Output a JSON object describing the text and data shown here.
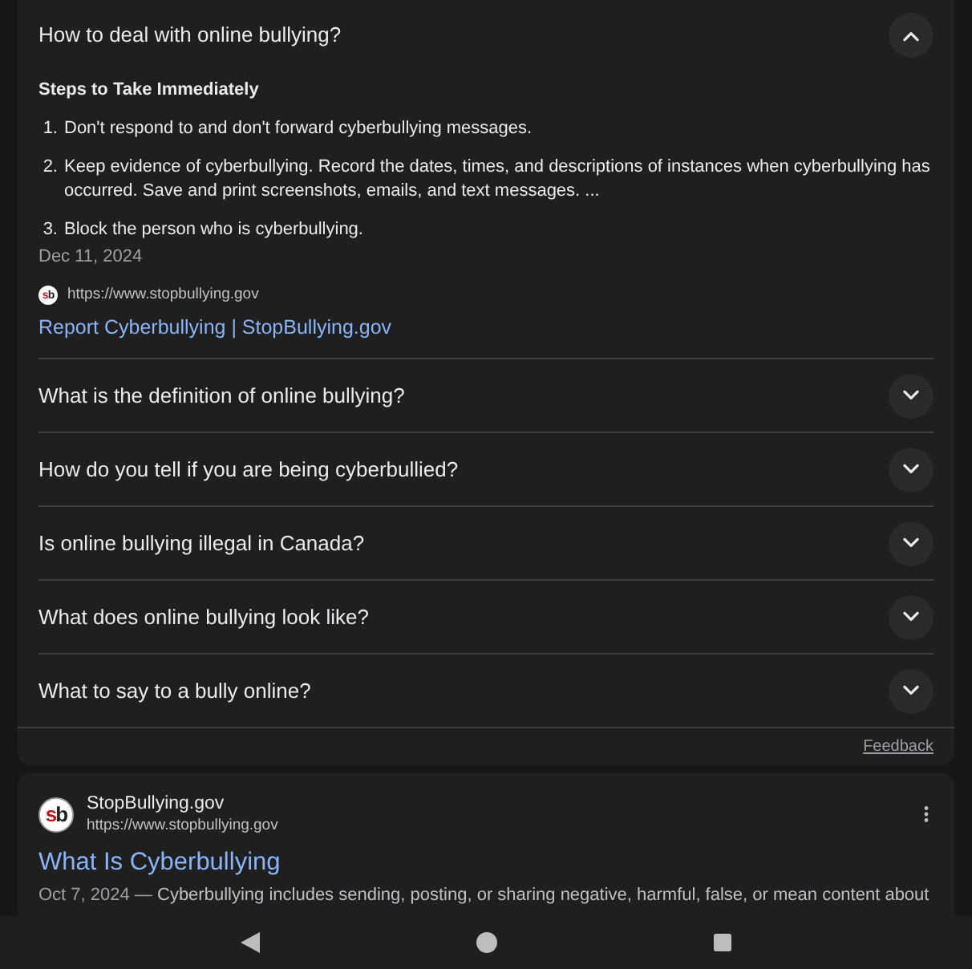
{
  "expanded_question": {
    "question": "How to deal with online bullying?",
    "expanded": true,
    "answer": {
      "heading": "Steps to Take Immediately",
      "steps": [
        {
          "number": "1.",
          "text": "Don't respond to and don't forward cyberbullying messages."
        },
        {
          "number": "2.",
          "text": "Keep evidence of cyberbullying. Record the dates, times, and descriptions of instances when cyberbullying has occurred. Save and print screenshots, emails, and text messages. ..."
        },
        {
          "number": "3.",
          "text": "Block the person who is cyberbullying."
        }
      ],
      "date": "Dec 11, 2024",
      "source_logo": "sb",
      "source_url": "https://www.stopbullying.gov",
      "source_title": "Report Cyberbullying | StopBullying.gov"
    }
  },
  "related_questions": [
    {
      "question": "What is the definition of online bullying?",
      "expanded": false
    },
    {
      "question": "How do you tell if you are being cyberbullied?",
      "expanded": false
    },
    {
      "question": "Is online bullying illegal in Canada?",
      "expanded": false
    },
    {
      "question": "What does online bullying look like?",
      "expanded": false
    },
    {
      "question": "What to say to a bully online?",
      "expanded": false
    }
  ],
  "feedback": "Feedback",
  "result": {
    "logo": "sb",
    "site_name": "StopBullying.gov",
    "url": "https://www.stopbullying.gov",
    "title": "What Is Cyberbullying",
    "date": "Oct 7, 2024 —",
    "snippet": "Cyberbullying includes sending, posting, or sharing negative, harmful, false, or mean content about"
  }
}
